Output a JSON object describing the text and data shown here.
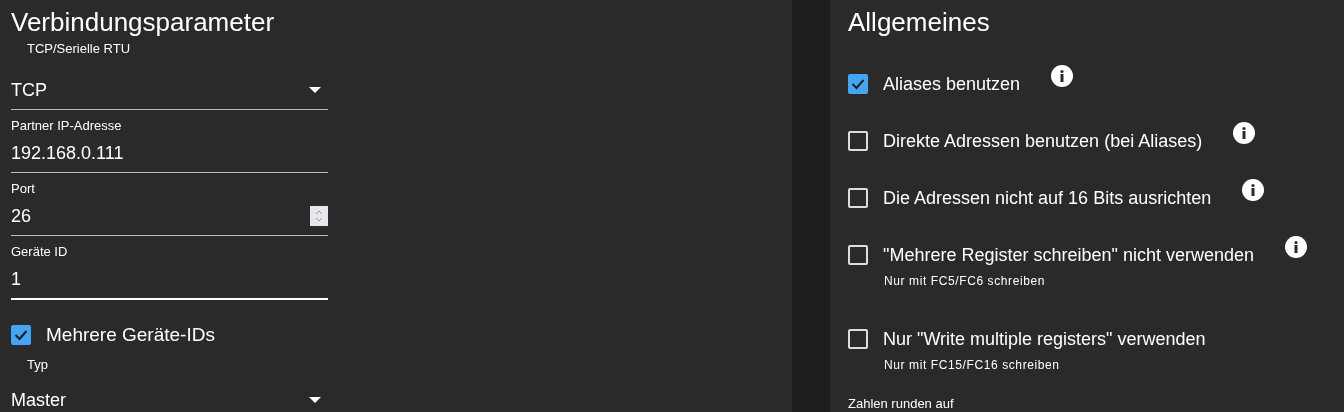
{
  "connection": {
    "title": "Verbindungsparameter",
    "fields": [
      {
        "kind": "select",
        "label": "TCP/Serielle RTU",
        "value": "TCP",
        "focused": false
      },
      {
        "kind": "text",
        "label": "Partner IP-Adresse",
        "value": "192.168.0.111",
        "focused": false
      },
      {
        "kind": "number",
        "label": "Port",
        "value": "26",
        "focused": false
      },
      {
        "kind": "text",
        "label": "Geräte ID",
        "value": "1",
        "focused": true
      }
    ],
    "multiple_ids": {
      "label": "Mehrere Geräte-IDs",
      "checked": true
    },
    "type_field": {
      "kind": "select",
      "label": "Typ",
      "value": "Master"
    }
  },
  "general": {
    "title": "Allgemeines",
    "options": [
      {
        "label": "Aliases benutzen",
        "checked": true,
        "info": true
      },
      {
        "label": "Direkte Adressen benutzen (bei Aliases)",
        "checked": false,
        "info": true
      },
      {
        "label": "Die Adressen nicht auf 16 Bits ausrichten",
        "checked": false,
        "info": true
      },
      {
        "label": "\"Mehrere Register schreiben\" nicht verwenden",
        "checked": false,
        "info": true,
        "hint": "Nur mit FC5/FC6 schreiben"
      },
      {
        "label": "Nur \"Write multiple registers\" verwenden",
        "checked": false,
        "info": false,
        "hint": "Nur mit FC15/FC16 schreiben"
      }
    ],
    "footer_label": "Zahlen runden auf"
  }
}
